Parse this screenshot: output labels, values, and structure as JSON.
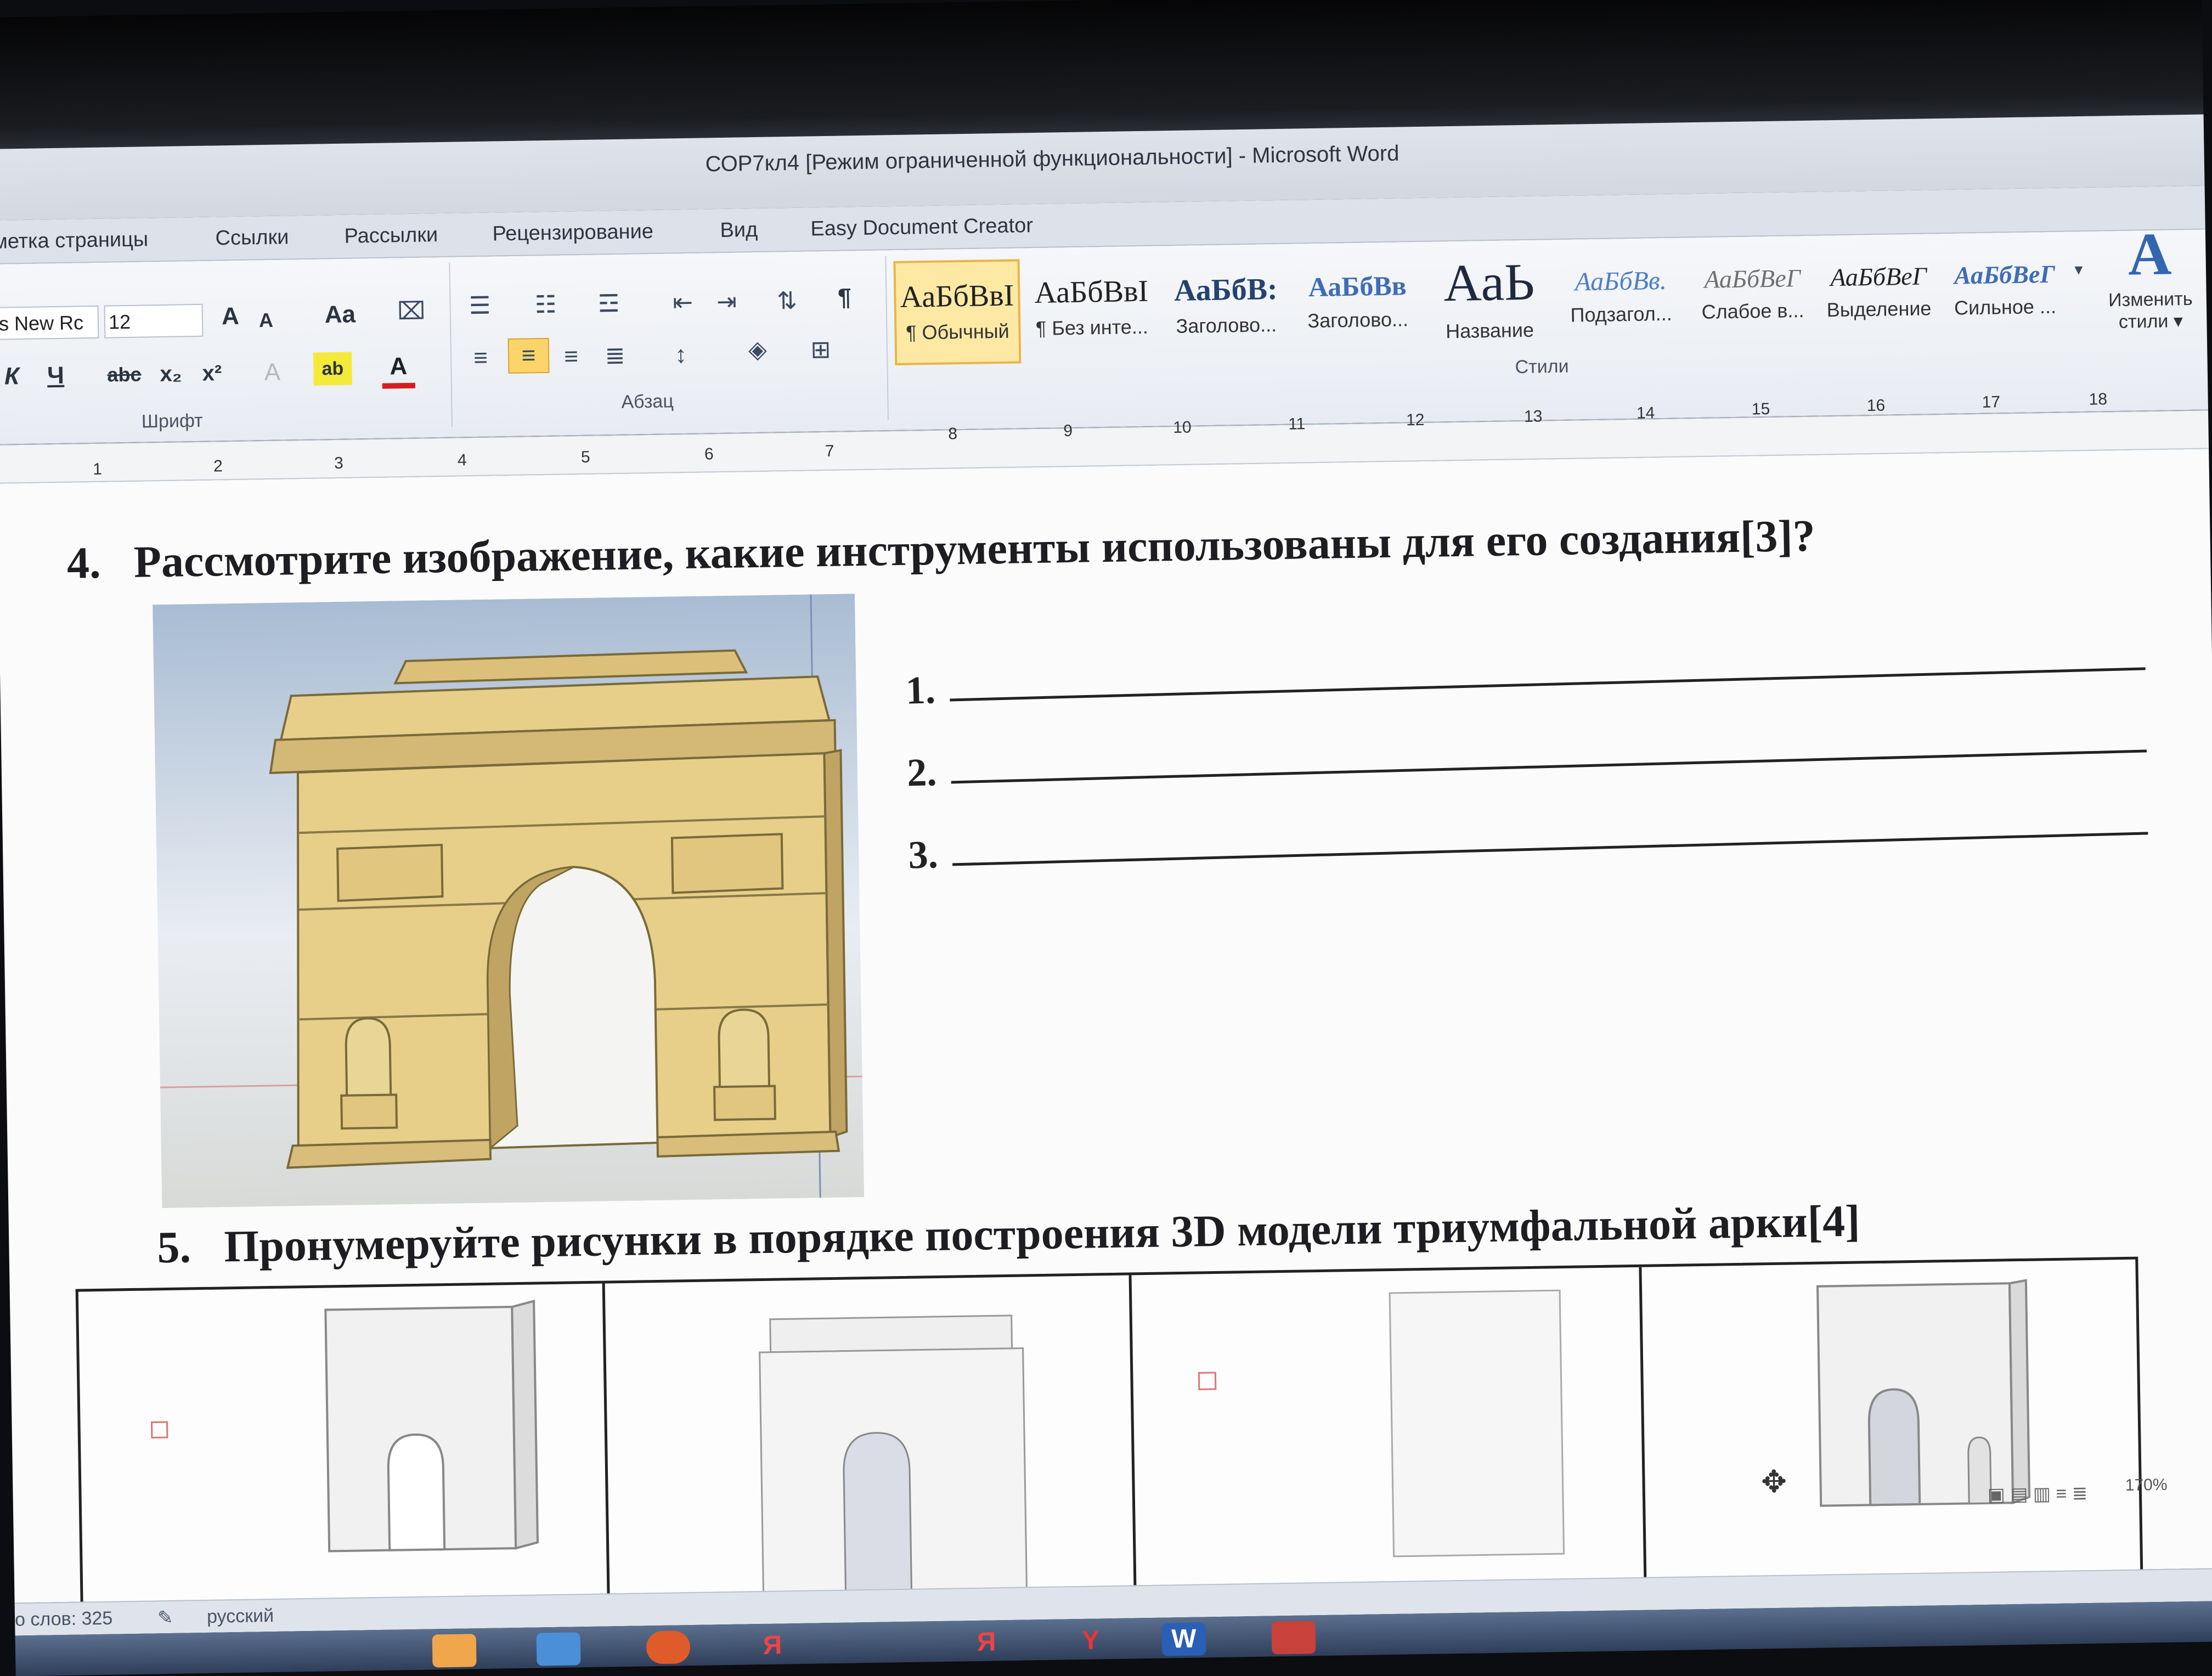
{
  "window": {
    "title": "СОР7кл4 [Режим ограниченной функциональности]  -  Microsoft Word"
  },
  "ribbon": {
    "tabs": [
      "метка страницы",
      "Ссылки",
      "Рассылки",
      "Рецензирование",
      "Вид",
      "Easy Document Creator"
    ],
    "font": {
      "name_value": "s New Rc",
      "size_value": "12",
      "group_label": "Шрифт",
      "grow_label": "A",
      "shrink_label": "A",
      "case_label": "Aa",
      "bold_label": "К",
      "underline_label": "Ч",
      "strike_label": "abc",
      "subscript_label": "x₂",
      "superscript_label": "x²",
      "highlight_label": "ab",
      "color_label": "A"
    },
    "paragraph": {
      "group_label": "Абзац",
      "pilcrow": "¶"
    },
    "styles": {
      "group_label": "Стили",
      "items": [
        {
          "sample": "АаБбВвI",
          "name": "¶ Обычный"
        },
        {
          "sample": "АаБбВвI",
          "name": "¶ Без инте..."
        },
        {
          "sample": "АаБбВ:",
          "name": "Заголово..."
        },
        {
          "sample": "АаБбВв",
          "name": "Заголово..."
        },
        {
          "sample": "АаЬ",
          "name": "Название"
        },
        {
          "sample": "АаБбВв.",
          "name": "Подзагол..."
        },
        {
          "sample": "АаБбВеГ",
          "name": "Слабое в..."
        },
        {
          "sample": "АаБбВеГ",
          "name": "Выделение"
        },
        {
          "sample": "АаБбВеГ",
          "name": "Сильное ..."
        }
      ],
      "change_icon": "A",
      "change_label_1": "Изменить",
      "change_label_2": "стили ▾"
    }
  },
  "ruler": {
    "top_numbers": [
      "8",
      "9",
      "10",
      "11",
      "12",
      "13",
      "14",
      "15",
      "16",
      "17",
      "18"
    ],
    "bottom_numbers": [
      "1",
      "2",
      "3",
      "4",
      "5",
      "6",
      "7"
    ]
  },
  "document": {
    "q4": {
      "number": "4.",
      "text": "Рассмотрите изображение, какие инструменты использованы для его создания[3]?"
    },
    "answers": [
      "1.",
      "2.",
      "3."
    ],
    "q5": {
      "number": "5.",
      "text": "Пронумеруйте рисунки в порядке построения 3D модели триумфальной арки[4]"
    }
  },
  "status": {
    "words": "о слов: 325",
    "language": "русский",
    "zoom": "170%"
  },
  "taskbar": {
    "icons": [
      "Я",
      "Y",
      "W"
    ]
  },
  "colors": {
    "arch_fill": "#e7cf8a",
    "arch_shadow": "#bfa463",
    "ribbon_selected": "#fde9a4",
    "accent_blue": "#3366b0"
  }
}
